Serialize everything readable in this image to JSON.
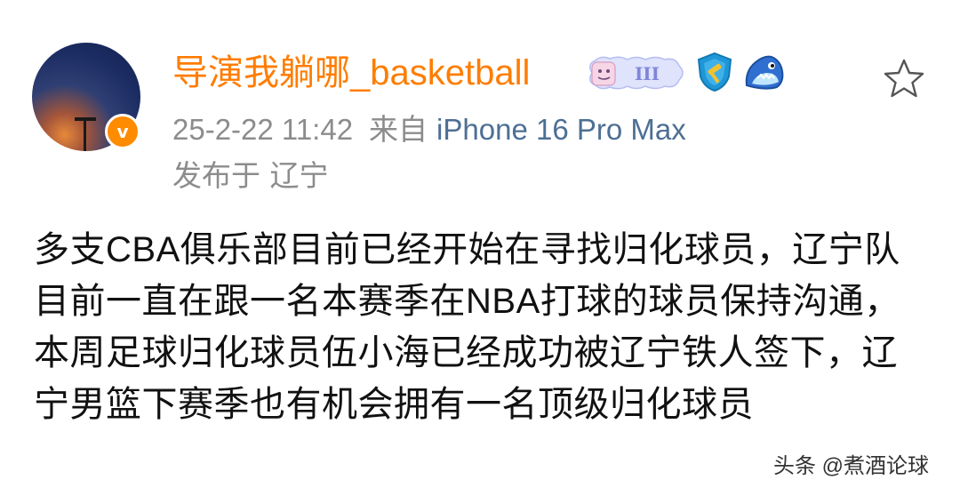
{
  "post": {
    "author": {
      "username": "导演我躺哪_basketball",
      "verified_badge_letter": "v",
      "level_badge_text": "III",
      "badges": [
        "level-badge",
        "shield-badge-icon",
        "shark-badge-icon"
      ]
    },
    "meta": {
      "timestamp": "25-2-22 11:42",
      "source_prefix": "来自",
      "device": "iPhone 16 Pro Max",
      "location": "发布于 辽宁"
    },
    "body_text": "多支CBA俱乐部目前已经开始在寻找归化球员，辽宁队目前一直在跟一名本赛季在NBA打球的球员保持沟通，本周足球归化球员伍小海已经成功被辽宁铁人签下，辽宁男篮下赛季也有机会拥有一名顶级归化球员"
  },
  "watermark": "头条 @煮酒论球",
  "colors": {
    "username": "#ff7d00",
    "meta_gray": "#8c8c8c",
    "device_link": "#4d6f94",
    "body_text": "#111111",
    "verified_badge": "#ff8b00"
  }
}
